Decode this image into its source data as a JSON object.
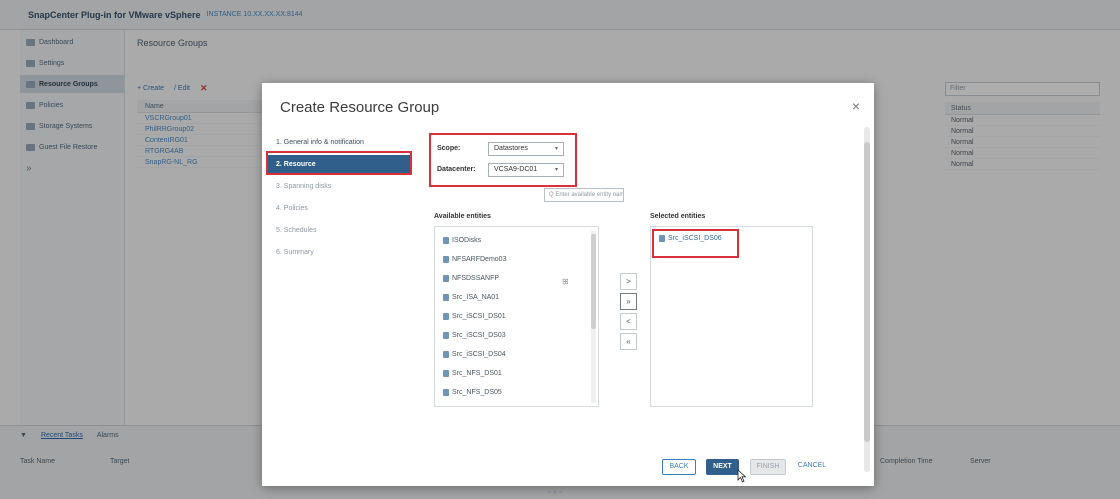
{
  "app": {
    "title": "SnapCenter Plug-in for VMware vSphere",
    "breadcrumb": "INSTANCE 10.XX.XX.XX:8144"
  },
  "nav": {
    "items": [
      {
        "label": "Dashboard"
      },
      {
        "label": "Settings"
      },
      {
        "label": "Resource Groups"
      },
      {
        "label": "Policies"
      },
      {
        "label": "Storage Systems"
      },
      {
        "label": "Guest File Restore"
      }
    ],
    "extra": "»"
  },
  "content": {
    "heading": "Resource Groups",
    "toolbar": {
      "create": "+ Create",
      "edit": "/ Edit",
      "delete": "✕"
    },
    "table": {
      "header": "Name",
      "rows": [
        "VSCRGroup01",
        "PhilRRGroup02",
        "ContentRG01",
        "RTGRG4AB",
        "SnapRG-NL_RG"
      ]
    },
    "filter_placeholder": "Filter",
    "right_col": {
      "header": "Status",
      "rows": [
        "Normal",
        "Normal",
        "Normal",
        "Normal",
        "Normal"
      ]
    }
  },
  "bottom": {
    "tabs": [
      "Recent Tasks",
      "Alarms"
    ],
    "columns": [
      "Task Name",
      "Target",
      "Completion Time",
      "Server"
    ]
  },
  "status_dock": "≈ ∧ ≈",
  "modal": {
    "title": "Create Resource Group",
    "close": "×",
    "steps": [
      {
        "label": "1. General info & notification",
        "state": "done"
      },
      {
        "label": "2. Resource",
        "state": "active"
      },
      {
        "label": "3. Spanning disks",
        "state": "pending"
      },
      {
        "label": "4. Policies",
        "state": "pending"
      },
      {
        "label": "5. Schedules",
        "state": "pending"
      },
      {
        "label": "6. Summary",
        "state": "pending"
      }
    ],
    "scope": {
      "label": "Scope:",
      "value": "Datastores"
    },
    "datacenter": {
      "label": "Datacenter:",
      "value": "VCSA9-DC01"
    },
    "search": {
      "placeholder": "Q  Enter available entity name"
    },
    "available": {
      "label": "Available entities",
      "items": [
        "ISODisks",
        "NFSARFDemo03",
        "NFSDSSANFP",
        "Src_ISA_NA01",
        "Src_iSCSI_DS01",
        "Src_iSCSI_DS03",
        "Src_iSCSI_DS04",
        "Src_NFS_DS01",
        "Src_NFS_DS05"
      ],
      "view_icon": "⊞"
    },
    "move_buttons": [
      ">",
      "»",
      "<",
      "«"
    ],
    "selected": {
      "label": "Selected entities",
      "items": [
        "Src_iSCSI_DS06"
      ]
    },
    "buttons": {
      "back": "BACK",
      "next": "NEXT",
      "finish": "FINISH",
      "cancel": "CANCEL"
    }
  }
}
